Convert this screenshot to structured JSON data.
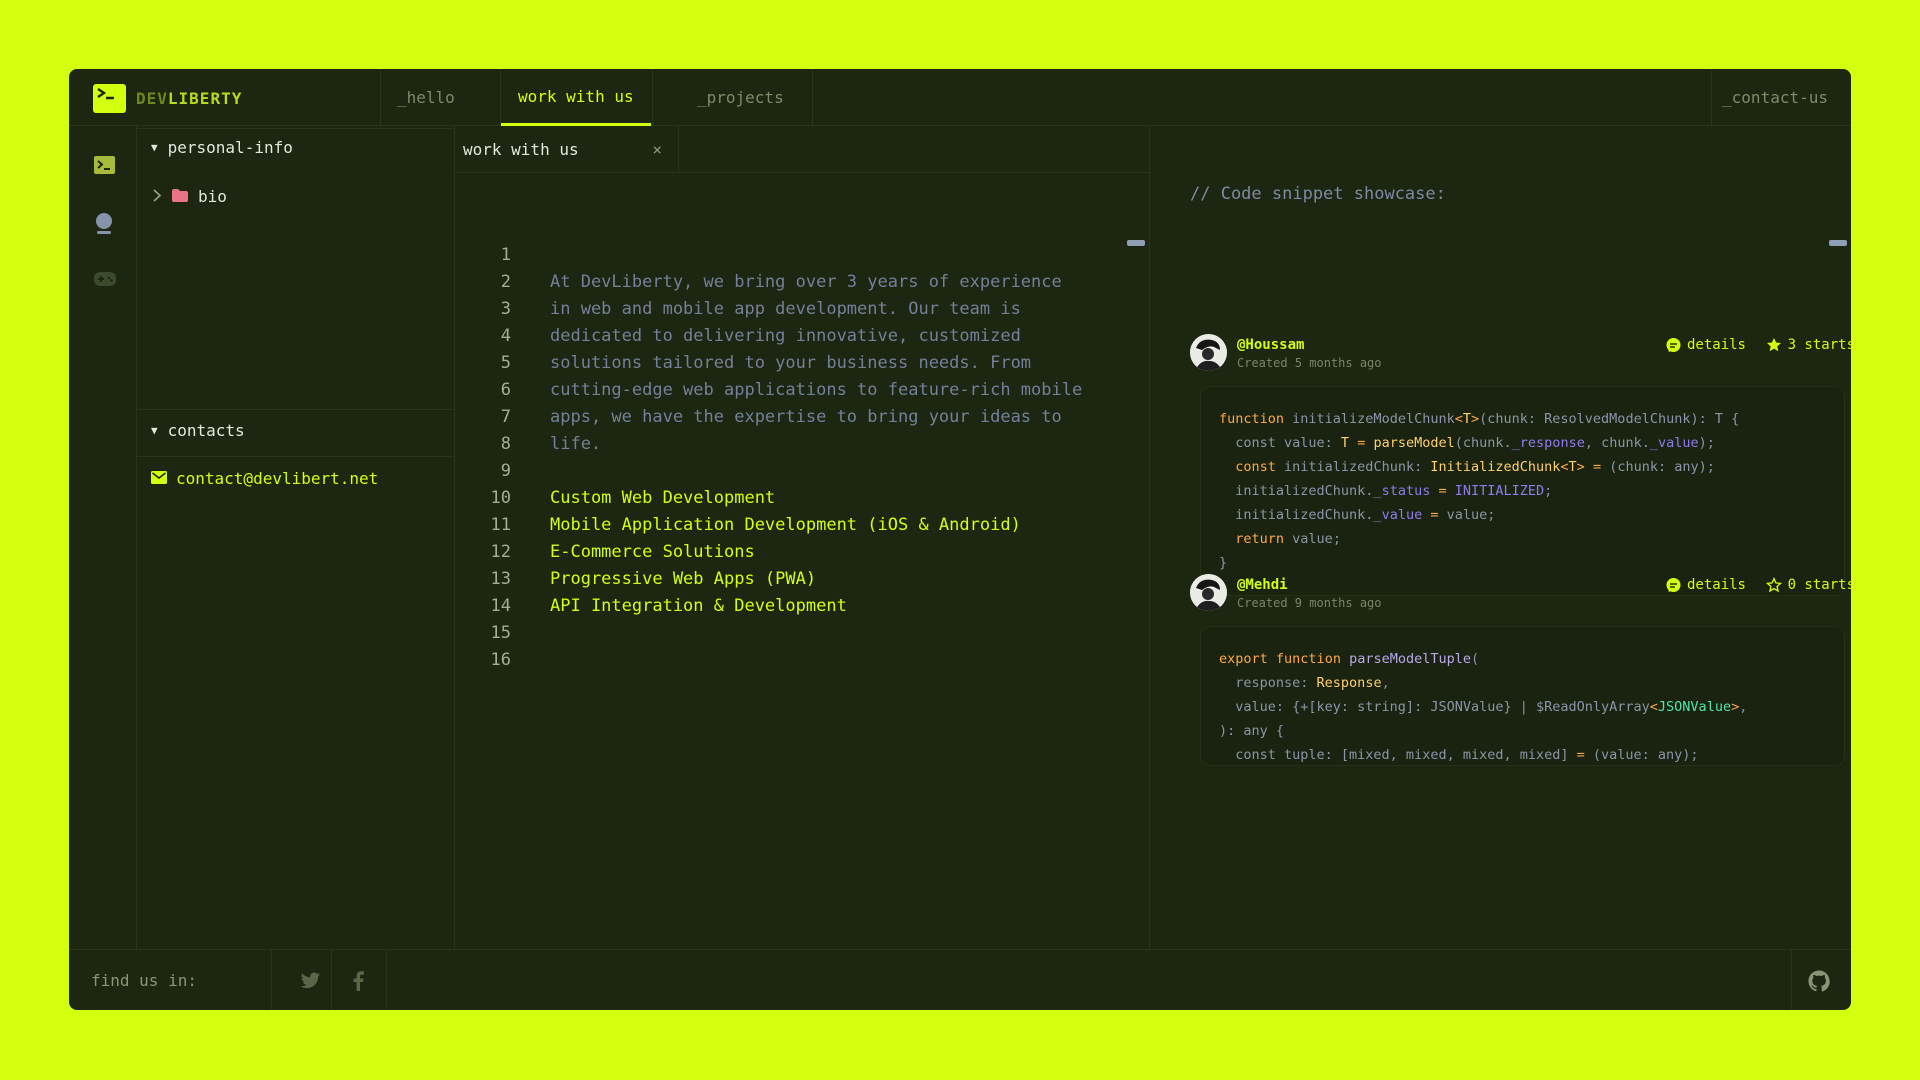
{
  "brand": {
    "part1": "DEV",
    "part2": "LIBERTY"
  },
  "nav": {
    "hello": "_hello",
    "work": "work with us",
    "projects": "_projects",
    "contact": "_contact-us"
  },
  "explorer": {
    "personal_info": "personal-info",
    "bio": "bio",
    "contacts": "contacts",
    "email": "contact@devlibert.net"
  },
  "editor": {
    "tab_label": "work with us",
    "close_glyph": "×",
    "line_numbers": [
      "1",
      "2",
      "3",
      "4",
      "5",
      "6",
      "7",
      "8",
      "9",
      "10",
      "11",
      "12",
      "13",
      "14",
      "15",
      "16"
    ],
    "lines": [
      "",
      "At DevLiberty, we bring over 3 years of experience",
      "in web and mobile app development. Our team is",
      "dedicated to delivering innovative, customized",
      "solutions tailored to your business needs. From",
      "cutting-edge web applications to feature-rich mobile",
      "apps, we have the expertise to bring your ideas to",
      "life.",
      "",
      "Custom Web Development",
      "Mobile Application Development (iOS & Android)",
      "E-Commerce Solutions",
      "Progressive Web Apps (PWA)",
      "API Integration & Development",
      "",
      ""
    ]
  },
  "showcase": {
    "title": "// Code snippet showcase:",
    "snippets": [
      {
        "user": "@Houssam",
        "time": "Created 5 months ago",
        "details": "details",
        "stars": "3 starts",
        "starred": true
      },
      {
        "user": "@Mehdi",
        "time": "Created 9 months ago",
        "details": "details",
        "stars": "0 starts",
        "starred": false
      }
    ]
  },
  "footer": {
    "find": "find us in:"
  },
  "colors": {
    "accent": "#d4ff0f",
    "window": "#1c2610",
    "folder": "#e9748a"
  }
}
